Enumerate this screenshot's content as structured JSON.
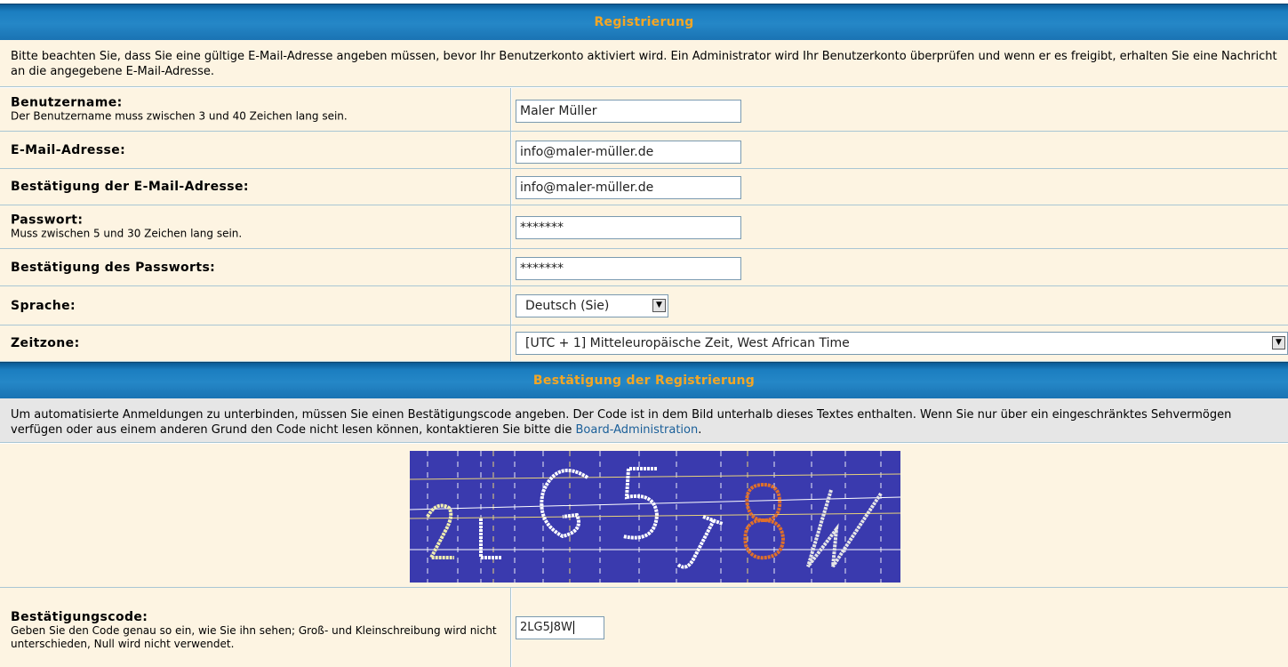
{
  "registration": {
    "header": "Registrierung",
    "intro": "Bitte beachten Sie, dass Sie eine gültige E-Mail-Adresse angeben müssen, bevor Ihr Benutzerkonto aktiviert wird. Ein Administrator wird Ihr Benutzerkonto überprüfen und wenn er es freigibt, erhalten Sie eine Nachricht an die angegebene E-Mail-Adresse.",
    "fields": {
      "username": {
        "label": "Benutzername:",
        "hint": "Der Benutzername muss zwischen 3 und 40 Zeichen lang sein.",
        "value": "Maler Müller"
      },
      "email": {
        "label": "E-Mail-Adresse:",
        "value": "info@maler-müller.de"
      },
      "email_confirm": {
        "label": "Bestätigung der E-Mail-Adresse:",
        "value": "info@maler-müller.de"
      },
      "password": {
        "label": "Passwort:",
        "hint": "Muss zwischen 5 und 30 Zeichen lang sein.",
        "value": "*******"
      },
      "password_confirm": {
        "label": "Bestätigung des Passworts:",
        "value": "*******"
      },
      "language": {
        "label": "Sprache:",
        "value": "Deutsch (Sie)"
      },
      "timezone": {
        "label": "Zeitzone:",
        "value": "[UTC + 1] Mitteleuropäische Zeit, West African Time"
      }
    }
  },
  "confirmation": {
    "header": "Bestätigung der Registrierung",
    "intro": "Um automatisierte Anmeldungen zu unterbinden, müssen Sie einen Bestätigungscode angeben. Der Code ist in dem Bild unterhalb dieses Textes enthalten. Wenn Sie nur über ein eingeschränktes Sehvermögen verfügen oder aus einem anderen Grund den Code nicht lesen können, kontaktieren Sie bitte die",
    "intro_link": "Board-Administration",
    "intro_end": ".",
    "captcha_characters": [
      "2",
      "L",
      "G",
      "5",
      "J",
      "8",
      "W"
    ],
    "code": {
      "label": "Bestätigungscode:",
      "hint": "Geben Sie den Code genau so ein, wie Sie ihn sehen; Groß- und Kleinschreibung wird nicht unterschieden, Null wird nicht verwendet.",
      "value": "2LG5J8W"
    }
  },
  "colors": {
    "header_text": "#f5a623",
    "header_bg": "#2587c7",
    "row_bg": "#fdf4e2",
    "captcha_bg": "#3a3aae",
    "link": "#1a5f99"
  }
}
